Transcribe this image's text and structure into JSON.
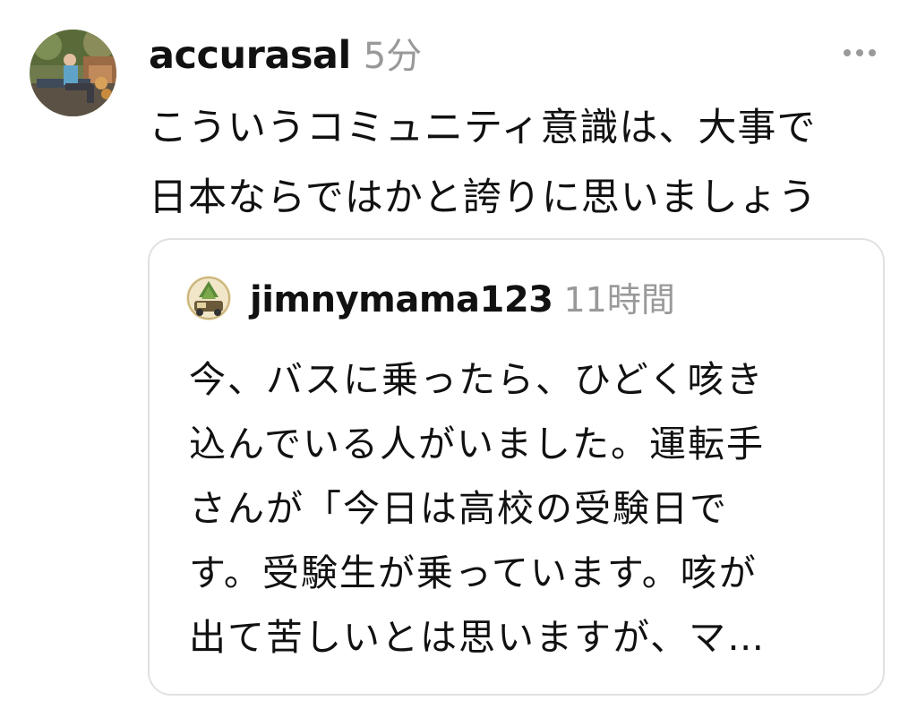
{
  "post": {
    "username": "accurasal",
    "timestamp": "5分",
    "avatar_icon": "user-photo-avatar",
    "more_icon": "more-horizontal-icon",
    "text_lines": [
      "こういうコミュニティ意識は、大事で",
      "日本ならではかと誇りに思いましょう"
    ]
  },
  "quoted_post": {
    "username": "jimnymama123",
    "timestamp": "11時間",
    "avatar_icon": "user-illustration-avatar",
    "text_lines": [
      "今、バスに乗ったら、ひどく咳き",
      "込んでいる人がいました。運転手",
      "さんが「今日は高校の受験日で",
      "す。受験生が乗っています。咳が",
      "出て苦しいとは思いますが、マ…"
    ]
  },
  "colors": {
    "text": "#111111",
    "meta": "#999999",
    "quote_border": "#e1e1e1",
    "background": "#ffffff"
  }
}
